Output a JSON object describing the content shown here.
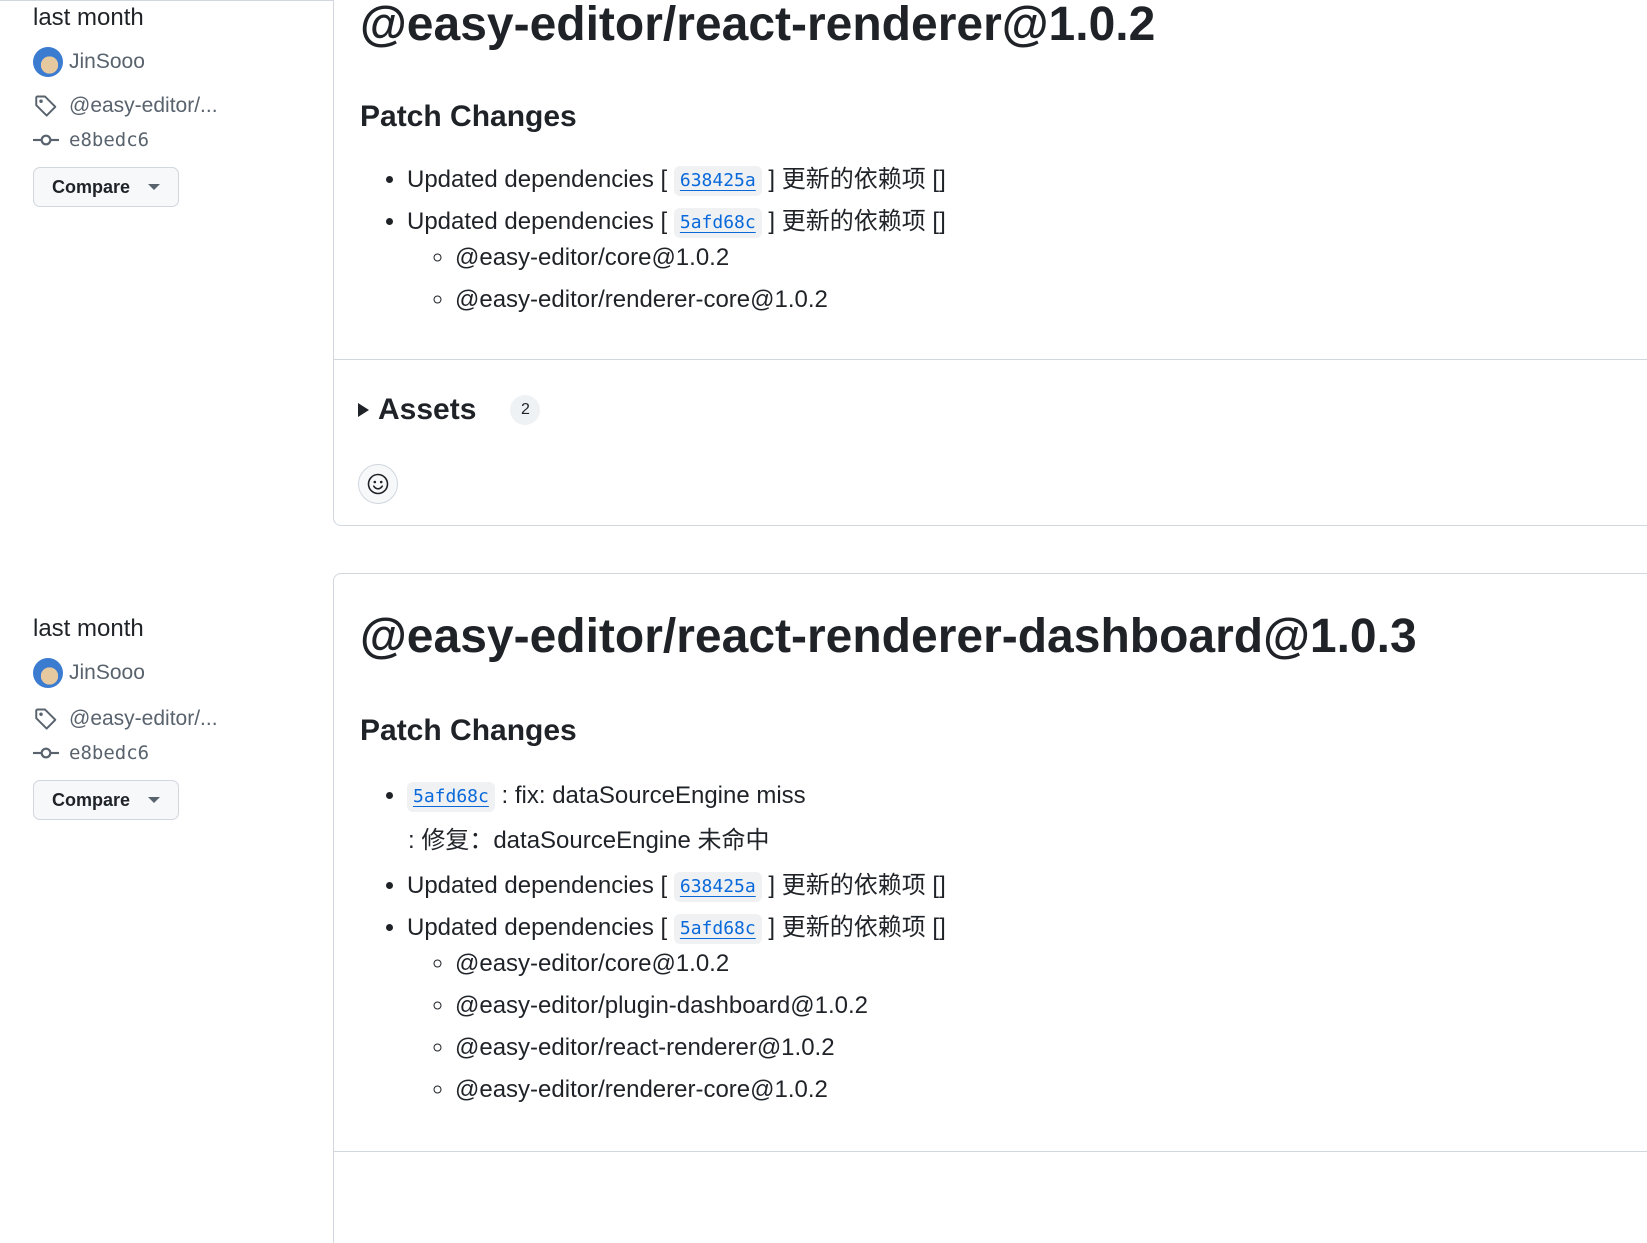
{
  "releases": [
    {
      "date": "last month",
      "author": "JinSooo",
      "tag": "@easy-editor/...",
      "commit": "e8bedc6",
      "compare_label": "Compare",
      "title": "@easy-editor/react-renderer@1.0.2",
      "section": "Patch Changes",
      "changes": [
        {
          "prefix": "Updated dependencies [",
          "sha": "638425a",
          "suffix": "] 更新的依赖项 []"
        },
        {
          "prefix": "Updated dependencies [",
          "sha": "5afd68c",
          "suffix": "]  更新的依赖项 []"
        }
      ],
      "deps": [
        "@easy-editor/core@1.0.2",
        "@easy-editor/renderer-core@1.0.2"
      ],
      "assets_label": "Assets",
      "assets_count": "2"
    },
    {
      "date": "last month",
      "author": "JinSooo",
      "tag": "@easy-editor/...",
      "commit": "e8bedc6",
      "compare_label": "Compare",
      "title": "@easy-editor/react-renderer-dashboard@1.0.3",
      "section": "Patch Changes",
      "fix": {
        "sha": "5afd68c",
        "text": ": fix: dataSourceEngine miss",
        "continuation": ":  修复：dataSourceEngine 未命中"
      },
      "changes": [
        {
          "prefix": "Updated dependencies [",
          "sha": "638425a",
          "suffix": "] 更新的依赖项 []"
        },
        {
          "prefix": "Updated dependencies [",
          "sha": "5afd68c",
          "suffix": "]  更新的依赖项 []"
        }
      ],
      "deps": [
        "@easy-editor/core@1.0.2",
        "@easy-editor/plugin-dashboard@1.0.2",
        "@easy-editor/react-renderer@1.0.2",
        "@easy-editor/renderer-core@1.0.2"
      ]
    }
  ],
  "icons": {
    "tag": "tag-icon",
    "commit": "git-commit-icon",
    "reaction": "smiley-icon",
    "dropdown": "triangle-down-icon"
  }
}
